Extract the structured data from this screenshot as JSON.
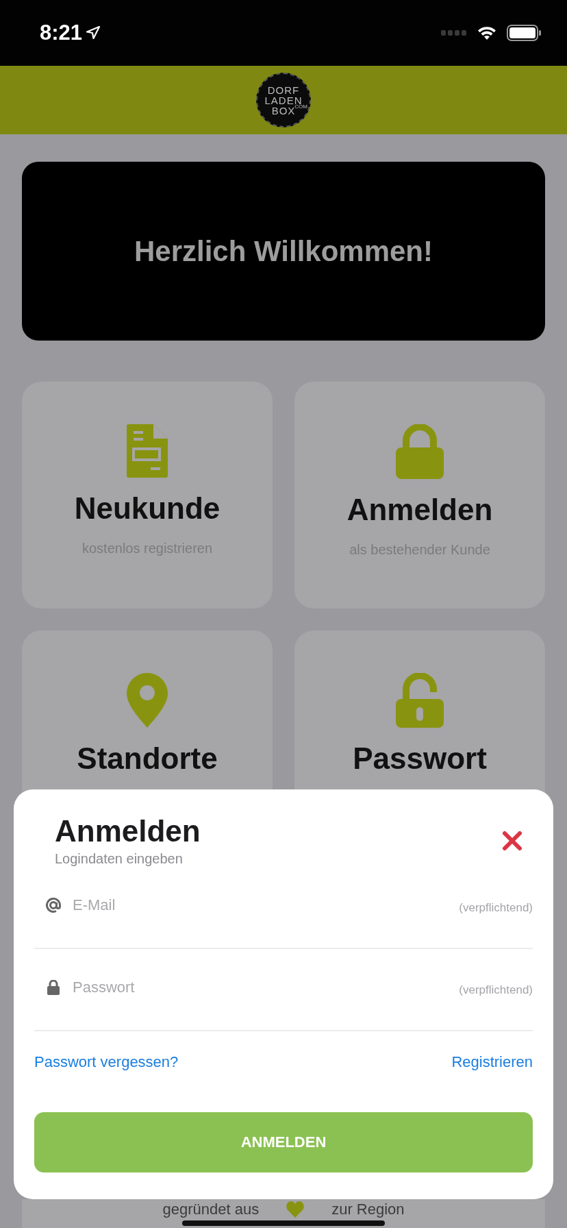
{
  "status_bar": {
    "time": "8:21"
  },
  "header": {
    "logo_lines": [
      "DORF",
      "LADEN",
      "BOX"
    ],
    "logo_suffix": "COM"
  },
  "welcome": {
    "title": "Herzlich Willkommen!"
  },
  "tiles": [
    {
      "kind": "document",
      "title": "Neukunde",
      "subtitle": "kostenlos registrieren"
    },
    {
      "kind": "lock",
      "title": "Anmelden",
      "subtitle": "als bestehender Kunde"
    },
    {
      "kind": "pin",
      "title": "Standorte"
    },
    {
      "kind": "unlock",
      "title": "Passwort"
    }
  ],
  "footer": {
    "left": "gegründet aus",
    "right": "zur Region"
  },
  "sheet": {
    "title": "Anmelden",
    "subtitle": "Logindaten eingeben",
    "fields": [
      {
        "kind": "email",
        "placeholder": "E-Mail",
        "hint": "(verpflichtend)"
      },
      {
        "kind": "password",
        "placeholder": "Passwort",
        "hint": "(verpflichtend)"
      }
    ],
    "links": [
      "Passwort vergessen?",
      "Registrieren"
    ],
    "button": "ANMELDEN"
  }
}
